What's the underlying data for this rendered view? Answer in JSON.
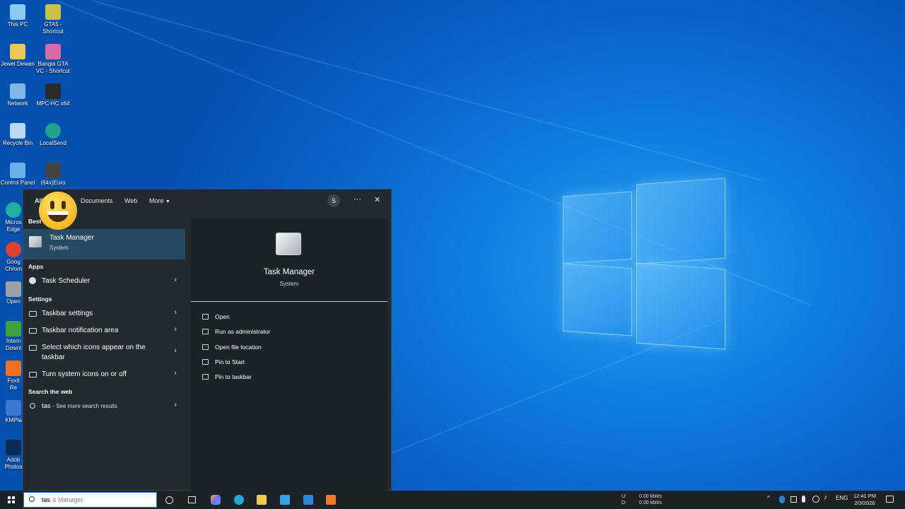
{
  "desktop": {
    "icons": [
      {
        "label": "This PC",
        "icon": "this-pc-icon",
        "color": "#8cc8f0"
      },
      {
        "label": "GTA5 - Shortcut",
        "icon": "gta5-icon",
        "color": "#c9c14a"
      },
      {
        "label": "Jewel Dewan",
        "icon": "user-folder-icon",
        "color": "#e8c85a"
      },
      {
        "label": "Bangla GTA VC - Shortcut",
        "icon": "gta-vc-icon",
        "color": "#d86aa8"
      },
      {
        "label": "Network",
        "icon": "network-icon",
        "color": "#7fb6e8"
      },
      {
        "label": "MPC-HC x64",
        "icon": "mpc-hc-icon",
        "color": "#2b2b2b"
      },
      {
        "label": "Recycle Bin",
        "icon": "recycle-bin-icon",
        "color": "#b8d8f0"
      },
      {
        "label": "LocalSend",
        "icon": "localsend-icon",
        "color": "#1fa38a"
      },
      {
        "label": "Control Panel",
        "icon": "control-panel-icon",
        "color": "#6ab0e8"
      },
      {
        "label": "(64x)Euro",
        "icon": "euro-truck-icon",
        "color": "#444"
      },
      {
        "label": "Micros Edge",
        "icon": "edge-icon",
        "color": "#1fb0a0"
      },
      {
        "label": "Goog Chrom",
        "icon": "chrome-icon",
        "color": "#e04030"
      },
      {
        "label": "Open",
        "icon": "open-app-icon",
        "color": "#9aa0a6"
      },
      {
        "label": "Intern Downl",
        "icon": "idm-icon",
        "color": "#3fa040"
      },
      {
        "label": "Foxit Re",
        "icon": "foxit-icon",
        "color": "#f07020"
      },
      {
        "label": "KMPla",
        "icon": "kmplayer-icon",
        "color": "#3a7ad0"
      },
      {
        "label": "Adob Photos",
        "icon": "photoshop-icon",
        "color": "#0a2a5a"
      }
    ]
  },
  "menu": {
    "tabs": [
      "All",
      "Documents",
      "Web",
      "More"
    ],
    "avatar_initial": "S",
    "more_options": "···",
    "close": "✕",
    "best_match_heading": "Best match",
    "best_match": {
      "title": "Task Manager",
      "subtitle": "System"
    },
    "apps_heading": "Apps",
    "apps": [
      {
        "label": "Task Scheduler"
      }
    ],
    "settings_heading": "Settings",
    "settings": [
      {
        "label": "Taskbar settings"
      },
      {
        "label": "Taskbar notification area"
      },
      {
        "label": "Select which icons appear on the",
        "label2": "taskbar"
      },
      {
        "label": "Turn system icons on or off"
      }
    ],
    "web_heading": "Search the web",
    "web_query": "tas",
    "web_suffix": "- See more search results",
    "chevron": "›",
    "detail": {
      "title": "Task Manager",
      "subtitle": "System",
      "actions": [
        "Open",
        "Run as administrator",
        "Open file location",
        "Pin to Start",
        "Pin to taskbar"
      ]
    }
  },
  "taskbar": {
    "search_typed": "tas",
    "search_ghost": "k Manager",
    "pinned": [
      {
        "name": "cortana-icon"
      },
      {
        "name": "task-view-icon"
      },
      {
        "name": "copilot-icon",
        "color": "#7b6cf0"
      },
      {
        "name": "edge-icon",
        "color": "#1fa8d8"
      },
      {
        "name": "file-explorer-icon",
        "color": "#f2c94c"
      },
      {
        "name": "store-icon",
        "color": "#3aa0e8"
      },
      {
        "name": "mail-icon",
        "color": "#2f86d8"
      },
      {
        "name": "app-icon",
        "color": "#f07a2a"
      }
    ],
    "net_up_label": "U:",
    "net_up": "0.00 kbit/s",
    "net_down_label": "D:",
    "net_down": "0.00 kbit/s",
    "language": "ENG",
    "time": "12:41 PM",
    "date": "2/3/2026"
  }
}
